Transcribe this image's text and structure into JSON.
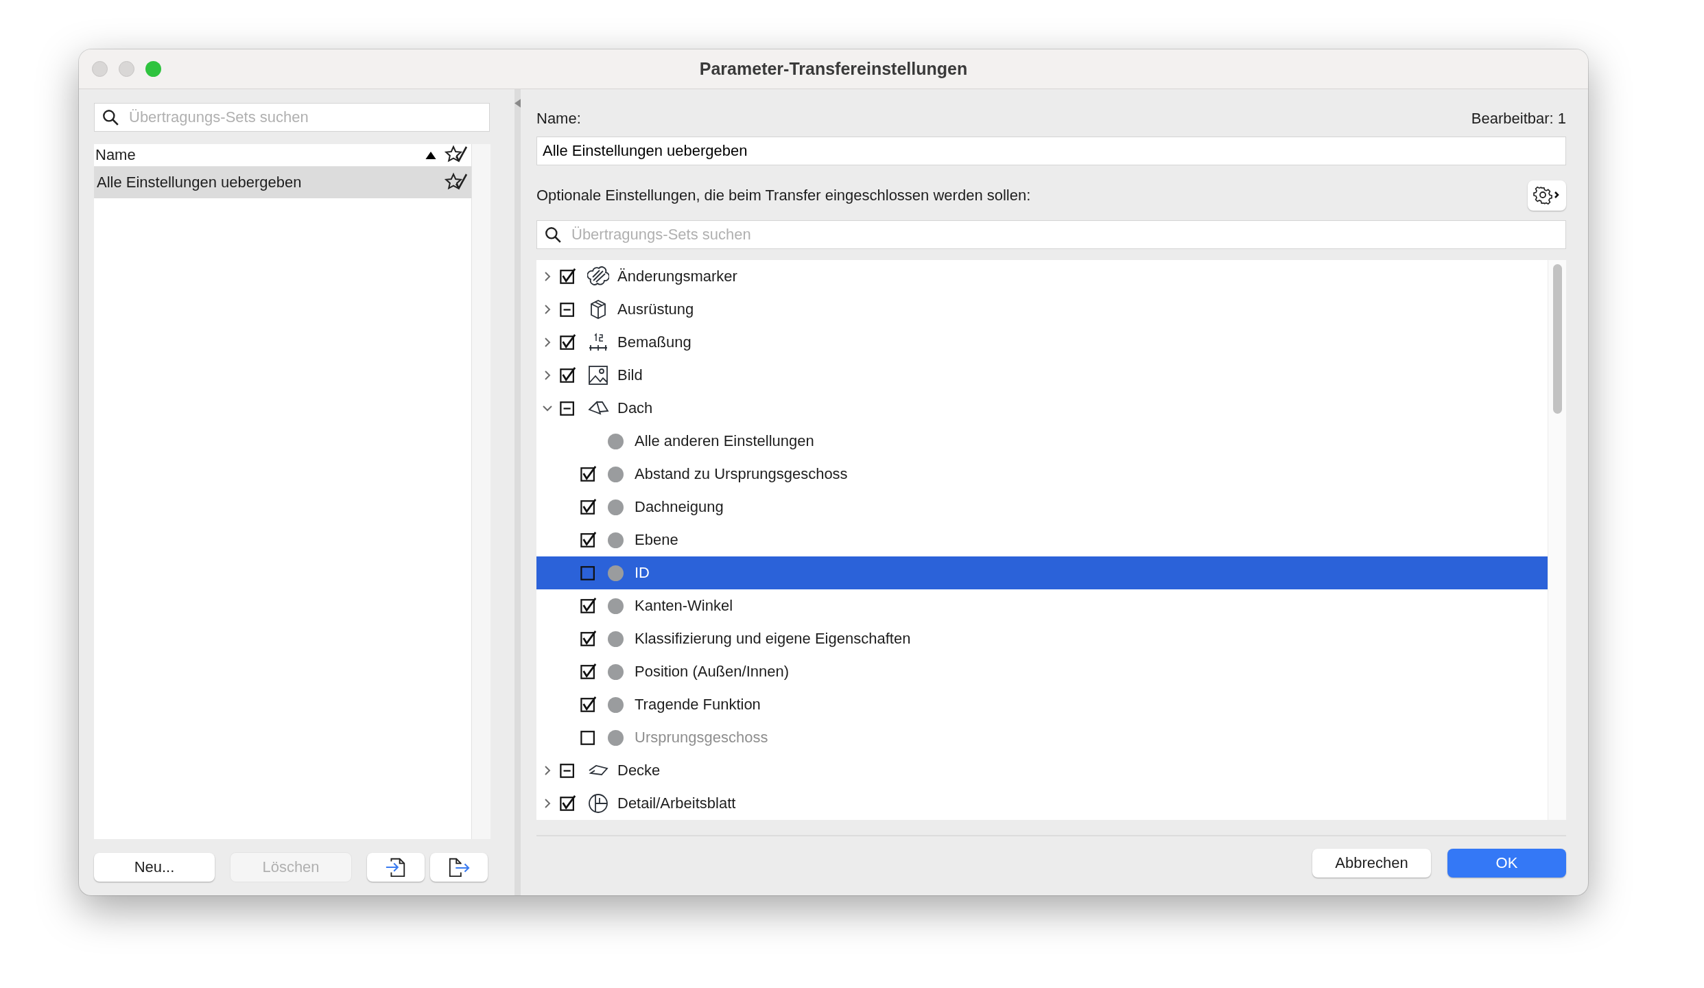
{
  "window": {
    "title": "Parameter-Transfereinstellungen"
  },
  "sidebar": {
    "search": {
      "placeholder": "Übertragungs-Sets suchen"
    },
    "column": {
      "label": "Name",
      "sort_ascending": true
    },
    "items": [
      {
        "label": "Alle Einstellungen uebergeben",
        "selected": true
      }
    ],
    "buttons": [
      {
        "kind": "text",
        "label": "Neu...",
        "disabled": false
      },
      {
        "kind": "text",
        "label": "Löschen",
        "disabled": true
      },
      {
        "kind": "import"
      },
      {
        "kind": "export"
      }
    ]
  },
  "name_label": "Name:",
  "editable": "Bearbeitbar: 1",
  "name_value": "Alle Einstellungen uebergeben",
  "options_label": "Optionale Einstellungen, die beim Transfer eingeschlossen werden sollen:",
  "options_search": {
    "placeholder": "Übertragungs-Sets suchen"
  },
  "tree": [
    {
      "label": "Änderungsmarker",
      "expanded": false,
      "checked": true,
      "mixed": false,
      "selected": false
    },
    {
      "label": "Ausrüstung",
      "expanded": false,
      "checked": false,
      "mixed": true,
      "selected": false
    },
    {
      "label": "Bemaßung",
      "expanded": false,
      "checked": true,
      "mixed": false,
      "selected": false
    },
    {
      "label": "Bild",
      "expanded": false,
      "checked": true,
      "mixed": false,
      "selected": false
    },
    {
      "label": "Dach",
      "expanded": true,
      "checked": false,
      "mixed": true,
      "selected": false,
      "children": [
        {
          "kind": "info",
          "label": "Alle anderen Einstellungen",
          "selected": false
        },
        {
          "kind": "option",
          "label": "Abstand zu Ursprungsgeschoss",
          "checked": true,
          "disabled": false,
          "selected": false
        },
        {
          "kind": "option",
          "label": "Dachneigung",
          "checked": true,
          "disabled": false,
          "selected": false
        },
        {
          "kind": "option",
          "label": "Ebene",
          "checked": true,
          "disabled": false,
          "selected": false
        },
        {
          "kind": "option",
          "label": "ID",
          "checked": false,
          "disabled": false,
          "selected": true
        },
        {
          "kind": "option",
          "label": "Kanten-Winkel",
          "checked": true,
          "disabled": false,
          "selected": false
        },
        {
          "kind": "option",
          "label": "Klassifizierung und eigene Eigenschaften",
          "checked": true,
          "disabled": false,
          "selected": false
        },
        {
          "kind": "option",
          "label": "Position (Außen/Innen)",
          "checked": true,
          "disabled": false,
          "selected": false
        },
        {
          "kind": "option",
          "label": "Tragende Funktion",
          "checked": true,
          "disabled": false,
          "selected": false
        },
        {
          "kind": "option",
          "label": "Ursprungsgeschoss",
          "checked": false,
          "disabled": true,
          "selected": false
        }
      ]
    },
    {
      "label": "Decke",
      "expanded": false,
      "checked": false,
      "mixed": true,
      "selected": false
    },
    {
      "label": "Detail/Arbeitsblatt",
      "expanded": false,
      "checked": true,
      "mixed": false,
      "selected": false
    }
  ],
  "buttons": [
    {
      "label": "Abbrechen",
      "primary": false
    },
    {
      "label": "OK",
      "primary": true
    }
  ]
}
